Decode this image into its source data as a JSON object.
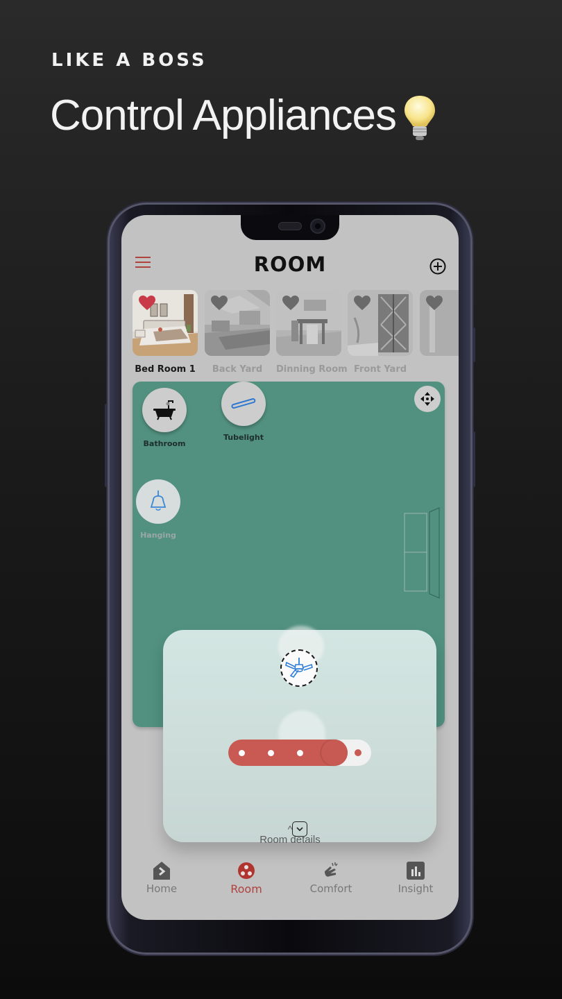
{
  "promo": {
    "kicker": "LIKE A BOSS",
    "title": "Control Appliances",
    "title_icon": "lightbulb-icon"
  },
  "app": {
    "title": "ROOM",
    "menu_icon": "hamburger-menu-icon",
    "add_icon": "plus-circle-icon",
    "accent": "#b0423e",
    "floor_color": "#52917f"
  },
  "rooms": [
    {
      "label": "Bed Room 1",
      "active": true,
      "favorite": true
    },
    {
      "label": "Back Yard",
      "active": false,
      "favorite": false
    },
    {
      "label": "Dinning Room",
      "active": false,
      "favorite": false
    },
    {
      "label": "Front Yard",
      "active": false,
      "favorite": false
    },
    {
      "label": "",
      "active": false,
      "favorite": false
    }
  ],
  "devices": [
    {
      "label": "Bathroom",
      "icon": "bathtub-icon"
    },
    {
      "label": "Tubelight",
      "icon": "tubelight-icon"
    },
    {
      "label": "Hanging",
      "icon": "hanging-lamp-icon"
    }
  ],
  "move_icon": "move-arrows-icon",
  "fan_control": {
    "device_icon": "ceiling-fan-icon",
    "speed_level": 4,
    "speed_steps": 5,
    "collapse_icon": "chevron-down-icon"
  },
  "details_toggle": {
    "caret": "^",
    "label": "Room details"
  },
  "tabs": [
    {
      "label": "Home",
      "icon": "home-icon",
      "active": false
    },
    {
      "label": "Room",
      "icon": "room-icon",
      "active": true
    },
    {
      "label": "Comfort",
      "icon": "comfort-snap-icon",
      "active": false
    },
    {
      "label": "Insight",
      "icon": "insight-chart-icon",
      "active": false
    }
  ]
}
